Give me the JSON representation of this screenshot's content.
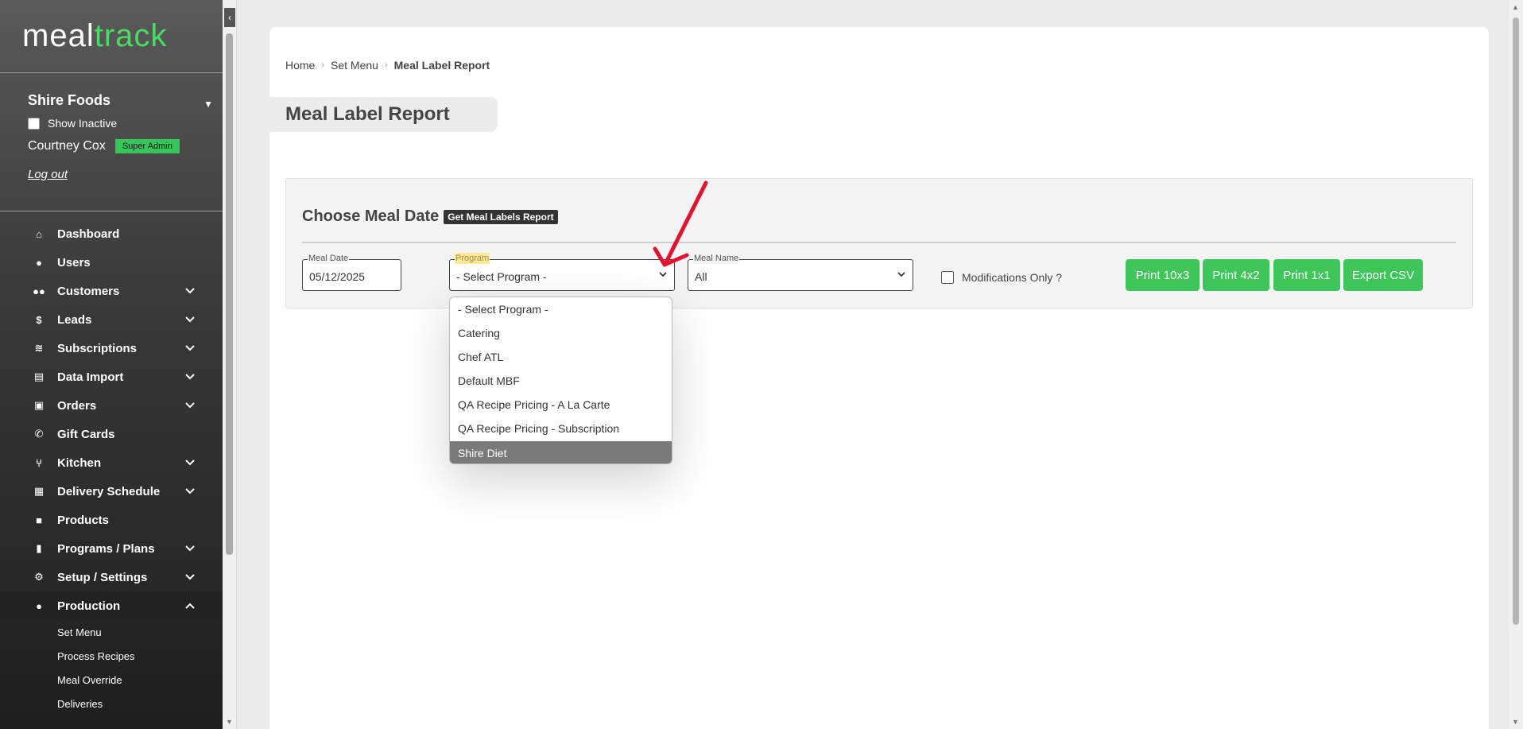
{
  "brand": {
    "part1": "meal",
    "part2": "track",
    "accent": "#4cd964"
  },
  "account": {
    "company": "Shire Foods",
    "show_inactive_label": "Show Inactive",
    "user_name": "Courtney Cox",
    "role_badge": "Super Admin",
    "logout_label": "Log out"
  },
  "nav": {
    "items": [
      {
        "label": "Dashboard",
        "icon": "home-icon"
      },
      {
        "label": "Users",
        "icon": "user-icon"
      },
      {
        "label": "Customers",
        "icon": "users-icon"
      },
      {
        "label": "Leads",
        "icon": "dollar-icon"
      },
      {
        "label": "Subscriptions",
        "icon": "layers-icon"
      },
      {
        "label": "Data Import",
        "icon": "file-icon"
      },
      {
        "label": "Orders",
        "icon": "bag-icon"
      },
      {
        "label": "Gift Cards",
        "icon": "phone-icon"
      },
      {
        "label": "Kitchen",
        "icon": "utensils-icon"
      },
      {
        "label": "Delivery Schedule",
        "icon": "calendar-icon"
      },
      {
        "label": "Products",
        "icon": "box-icon"
      },
      {
        "label": "Programs / Plans",
        "icon": "clipboard-icon"
      },
      {
        "label": "Setup / Settings",
        "icon": "gear-icon"
      },
      {
        "label": "Production",
        "icon": "user-icon"
      }
    ],
    "production_sub": [
      "Set Menu",
      "Process Recipes",
      "Meal Override",
      "Deliveries"
    ]
  },
  "breadcrumb": {
    "home": "Home",
    "set_menu": "Set Menu",
    "current": "Meal Label Report"
  },
  "page_title": "Meal Label Report",
  "panel": {
    "title": "Choose Meal Date",
    "report_button": "Get Meal Labels Report",
    "meal_date": {
      "legend": "Meal Date",
      "value": "05/12/2025"
    },
    "program": {
      "legend": "Program",
      "value": "- Select Program -"
    },
    "meal_name": {
      "legend": "Meal Name",
      "value": "All"
    },
    "modifications_label": "Modifications Only ?",
    "buttons": {
      "print_10x3": "Print 10x3",
      "print_4x2": "Print 4x2",
      "print_1x1": "Print 1x1",
      "export_csv": "Export CSV"
    }
  },
  "program_options": [
    "- Select Program -",
    "Catering",
    "Chef ATL",
    "Default MBF",
    "QA Recipe Pricing - A La Carte",
    "QA Recipe Pricing - Subscription",
    "Shire Diet"
  ],
  "selected_option": "Shire Diet",
  "colors": {
    "button_green": "#3fc65a",
    "annotation_red": "#e0142f",
    "highlight_yellow": "#fde79a"
  }
}
